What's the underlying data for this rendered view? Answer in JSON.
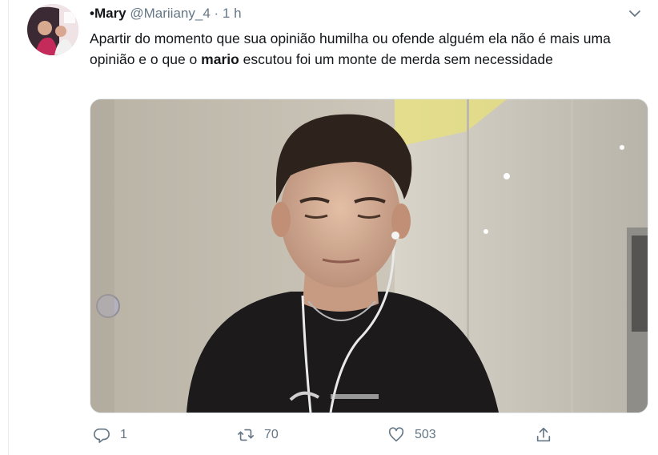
{
  "tweet": {
    "display_name": "•Mary",
    "handle": "@Mariiany_4",
    "separator": "·",
    "time": "1 h",
    "text_before": "Apartir do momento que sua opinião humilha ou ofende alguém ela não é mais uma opinião e o que o ",
    "text_bold": "mario",
    "text_after": " escutou foi um monte de merda sem necessidade",
    "media_icon": "video-thumbnail",
    "icons": {
      "more": "chevron-down-icon",
      "reply": "reply-icon",
      "retweet": "retweet-icon",
      "like": "heart-icon",
      "share": "share-icon"
    },
    "counts": {
      "reply": "1",
      "retweet": "70",
      "like": "503"
    }
  },
  "colors": {
    "text": "#14171a",
    "secondary": "#657786",
    "border": "#e6ecf0"
  }
}
